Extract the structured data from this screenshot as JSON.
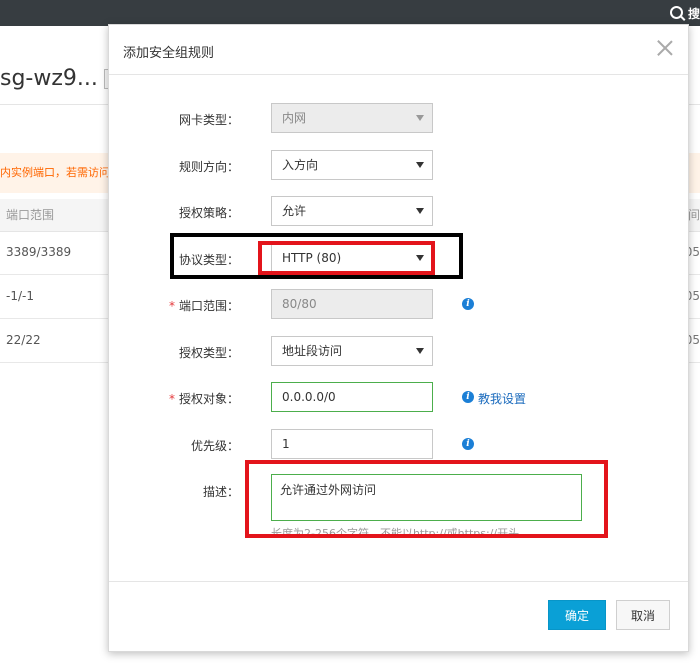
{
  "topbar": {
    "search_label": "搜"
  },
  "background_page": {
    "title": "sg-wz9...",
    "notice_left": "内实例端口，若需访问",
    "notice_right": "",
    "table_header": {
      "port_range": "端口范围",
      "right": "间"
    },
    "rows": [
      {
        "port_range": "3389/3389",
        "right": "05"
      },
      {
        "port_range": "-1/-1",
        "right": "05"
      },
      {
        "port_range": "22/22",
        "right": "05"
      }
    ]
  },
  "dialog": {
    "title": "添加安全组规则",
    "fields": {
      "nic_type": {
        "label": "网卡类型：",
        "value": "内网"
      },
      "direction": {
        "label": "规则方向：",
        "value": "入方向"
      },
      "policy": {
        "label": "授权策略：",
        "value": "允许"
      },
      "protocol": {
        "label": "协议类型：",
        "value": "HTTP (80)"
      },
      "port_range": {
        "label": "端口范围：",
        "value": "80/80"
      },
      "auth_type": {
        "label": "授权类型：",
        "value": "地址段访问"
      },
      "auth_object": {
        "label": "授权对象：",
        "value": "0.0.0.0/0",
        "help_link": "教我设置"
      },
      "priority": {
        "label": "优先级：",
        "value": "1"
      },
      "description": {
        "label": "描述：",
        "value": "允许通过外网访问",
        "hint": "长度为2-256个字符，不能以http://或https://开头"
      }
    },
    "required_mark": "*",
    "info_glyph": "i",
    "buttons": {
      "confirm": "确定",
      "cancel": "取消"
    }
  },
  "colors": {
    "primary": "#0aa0d6",
    "valid_border": "#4cae4c",
    "annotation_red": "#e3141b",
    "annotation_black": "#000000"
  }
}
